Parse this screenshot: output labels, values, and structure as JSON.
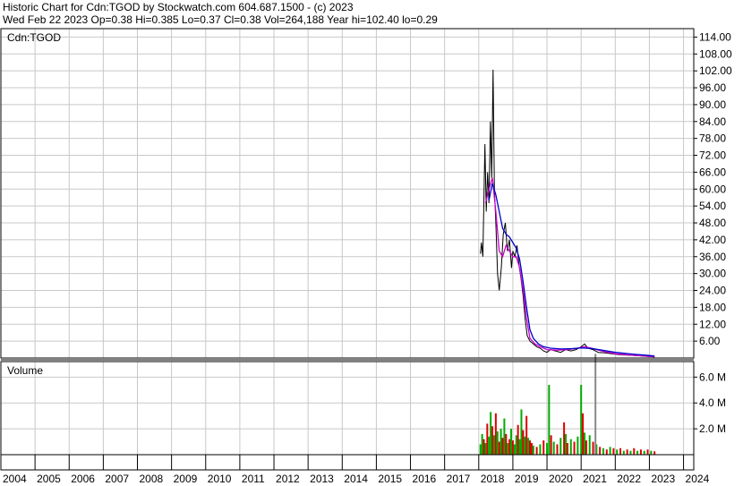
{
  "header": {
    "line1": "Historic Chart for Cdn:TGOD by Stockwatch.com 604.687.1500 - (c) 2023",
    "line2": "Wed Feb 22 2023   Op=0.38   Hi=0.385   Lo=0.37   Cl=0.38   Vol=264,188   Year hi=102.40   lo=0.29"
  },
  "colors": {
    "grid": "#c8c8c8",
    "price_line": "#000000",
    "ma_short": "#cc00cc",
    "ma_long": "#0000cc",
    "vol_up": "#00aa00",
    "vol_down": "#dd0000",
    "vol_spike": "#888888"
  },
  "chart_data": [
    {
      "type": "line",
      "panel_label": "Cdn:TGOD",
      "x_ticks": [
        "2004",
        "2005",
        "2006",
        "2007",
        "2008",
        "2009",
        "2010",
        "2011",
        "2012",
        "2013",
        "2014",
        "2015",
        "2016",
        "2017",
        "2018",
        "2019",
        "2020",
        "2021",
        "2022",
        "2023",
        "2024"
      ],
      "y_ticks": [
        "114.00",
        "108.00",
        "102.00",
        "96.00",
        "90.00",
        "84.00",
        "78.00",
        "72.00",
        "66.00",
        "60.00",
        "54.00",
        "48.00",
        "42.00",
        "36.00",
        "30.00",
        "24.00",
        "18.00",
        "12.00",
        "6.00"
      ],
      "ylim": [
        0,
        117
      ],
      "xlim": [
        2004.0,
        2024.3
      ],
      "grid": true,
      "series": [
        {
          "role": "price",
          "points": [
            [
              2018.05,
              37
            ],
            [
              2018.08,
              41
            ],
            [
              2018.12,
              36
            ],
            [
              2018.18,
              76
            ],
            [
              2018.22,
              52
            ],
            [
              2018.26,
              66
            ],
            [
              2018.3,
              55
            ],
            [
              2018.34,
              84
            ],
            [
              2018.38,
              64
            ],
            [
              2018.42,
              102.4
            ],
            [
              2018.46,
              60
            ],
            [
              2018.5,
              48
            ],
            [
              2018.55,
              30
            ],
            [
              2018.6,
              24
            ],
            [
              2018.66,
              32
            ],
            [
              2018.72,
              44
            ],
            [
              2018.78,
              48
            ],
            [
              2018.84,
              38
            ],
            [
              2018.9,
              42
            ],
            [
              2018.96,
              32
            ],
            [
              2019.0,
              38
            ],
            [
              2019.06,
              36
            ],
            [
              2019.12,
              40
            ],
            [
              2019.18,
              33
            ],
            [
              2019.24,
              28
            ],
            [
              2019.3,
              22
            ],
            [
              2019.36,
              14
            ],
            [
              2019.42,
              8
            ],
            [
              2019.5,
              6
            ],
            [
              2019.6,
              5
            ],
            [
              2019.7,
              4
            ],
            [
              2019.8,
              3.5
            ],
            [
              2019.9,
              2.5
            ],
            [
              2020.0,
              2
            ],
            [
              2020.1,
              3
            ],
            [
              2020.25,
              2.5
            ],
            [
              2020.4,
              2
            ],
            [
              2020.55,
              3
            ],
            [
              2020.7,
              2.5
            ],
            [
              2020.85,
              3
            ],
            [
              2021.0,
              4
            ],
            [
              2021.1,
              5
            ],
            [
              2021.2,
              3.5
            ],
            [
              2021.35,
              3
            ],
            [
              2021.5,
              2
            ],
            [
              2021.7,
              1.8
            ],
            [
              2021.9,
              1.5
            ],
            [
              2022.1,
              1.2
            ],
            [
              2022.4,
              1.0
            ],
            [
              2022.7,
              0.8
            ],
            [
              2023.0,
              0.5
            ],
            [
              2023.15,
              0.38
            ]
          ]
        },
        {
          "role": "moving-average-short",
          "points": [
            [
              2018.2,
              55
            ],
            [
              2018.3,
              60
            ],
            [
              2018.4,
              64
            ],
            [
              2018.5,
              52
            ],
            [
              2018.6,
              38
            ],
            [
              2018.7,
              36
            ],
            [
              2018.8,
              40
            ],
            [
              2018.9,
              38
            ],
            [
              2019.0,
              36
            ],
            [
              2019.1,
              36
            ],
            [
              2019.2,
              32
            ],
            [
              2019.3,
              24
            ],
            [
              2019.4,
              14
            ],
            [
              2019.5,
              7
            ],
            [
              2019.65,
              5
            ],
            [
              2019.8,
              4
            ],
            [
              2020.0,
              3
            ],
            [
              2020.3,
              2.8
            ],
            [
              2020.6,
              3
            ],
            [
              2020.9,
              3.5
            ],
            [
              2021.1,
              4
            ],
            [
              2021.3,
              3.5
            ],
            [
              2021.6,
              2.5
            ],
            [
              2022.0,
              1.5
            ],
            [
              2022.5,
              1.0
            ],
            [
              2023.0,
              0.6
            ],
            [
              2023.15,
              0.45
            ]
          ]
        },
        {
          "role": "moving-average-long",
          "points": [
            [
              2018.3,
              56
            ],
            [
              2018.4,
              62
            ],
            [
              2018.5,
              58
            ],
            [
              2018.6,
              52
            ],
            [
              2018.7,
              46
            ],
            [
              2018.8,
              44
            ],
            [
              2018.9,
              43
            ],
            [
              2019.0,
              41
            ],
            [
              2019.1,
              39
            ],
            [
              2019.2,
              35
            ],
            [
              2019.3,
              27
            ],
            [
              2019.4,
              18
            ],
            [
              2019.5,
              10
            ],
            [
              2019.6,
              7
            ],
            [
              2019.75,
              5
            ],
            [
              2019.9,
              4
            ],
            [
              2020.1,
              3.5
            ],
            [
              2020.4,
              3.2
            ],
            [
              2020.7,
              3.3
            ],
            [
              2021.0,
              3.6
            ],
            [
              2021.3,
              3.4
            ],
            [
              2021.6,
              2.8
            ],
            [
              2022.0,
              2.0
            ],
            [
              2022.5,
              1.4
            ],
            [
              2023.0,
              0.9
            ],
            [
              2023.15,
              0.7
            ]
          ]
        }
      ]
    },
    {
      "type": "bar",
      "panel_label": "Volume",
      "y_ticks": [
        "6.0 M",
        "4.0 M",
        "2.0 M"
      ],
      "ylim": [
        0,
        7.2
      ],
      "xlim": [
        2004.0,
        2024.3
      ],
      "grid": true,
      "bars": [
        [
          2018.05,
          0.8,
          "up"
        ],
        [
          2018.1,
          1.6,
          "up"
        ],
        [
          2018.15,
          1.2,
          "down"
        ],
        [
          2018.2,
          0.9,
          "up"
        ],
        [
          2018.25,
          2.4,
          "down"
        ],
        [
          2018.3,
          1.4,
          "up"
        ],
        [
          2018.35,
          3.3,
          "up"
        ],
        [
          2018.4,
          2.2,
          "down"
        ],
        [
          2018.45,
          1.5,
          "up"
        ],
        [
          2018.5,
          3.2,
          "down"
        ],
        [
          2018.55,
          1.8,
          "up"
        ],
        [
          2018.6,
          1.0,
          "down"
        ],
        [
          2018.65,
          2.0,
          "up"
        ],
        [
          2018.7,
          1.3,
          "down"
        ],
        [
          2018.75,
          2.8,
          "up"
        ],
        [
          2018.8,
          1.6,
          "down"
        ],
        [
          2018.85,
          0.9,
          "up"
        ],
        [
          2018.9,
          1.2,
          "down"
        ],
        [
          2018.95,
          2.0,
          "up"
        ],
        [
          2019.0,
          1.1,
          "down"
        ],
        [
          2019.05,
          0.8,
          "up"
        ],
        [
          2019.1,
          1.5,
          "up"
        ],
        [
          2019.15,
          2.3,
          "down"
        ],
        [
          2019.2,
          1.2,
          "up"
        ],
        [
          2019.25,
          3.5,
          "up"
        ],
        [
          2019.3,
          1.9,
          "down"
        ],
        [
          2019.35,
          1.4,
          "up"
        ],
        [
          2019.4,
          3.0,
          "down"
        ],
        [
          2019.45,
          1.3,
          "up"
        ],
        [
          2019.5,
          1.1,
          "down"
        ],
        [
          2019.55,
          0.9,
          "down"
        ],
        [
          2019.6,
          0.7,
          "up"
        ],
        [
          2019.7,
          0.6,
          "down"
        ],
        [
          2019.8,
          0.8,
          "up"
        ],
        [
          2019.9,
          1.1,
          "down"
        ],
        [
          2020.0,
          0.9,
          "up"
        ],
        [
          2020.06,
          5.4,
          "up"
        ],
        [
          2020.12,
          1.5,
          "down"
        ],
        [
          2020.2,
          1.0,
          "up"
        ],
        [
          2020.3,
          0.8,
          "down"
        ],
        [
          2020.4,
          1.3,
          "up"
        ],
        [
          2020.5,
          2.5,
          "down"
        ],
        [
          2020.55,
          1.6,
          "up"
        ],
        [
          2020.6,
          0.9,
          "down"
        ],
        [
          2020.7,
          1.2,
          "up"
        ],
        [
          2020.8,
          1.0,
          "down"
        ],
        [
          2020.9,
          1.4,
          "up"
        ],
        [
          2021.0,
          5.4,
          "up"
        ],
        [
          2021.05,
          3.2,
          "down"
        ],
        [
          2021.1,
          1.7,
          "up"
        ],
        [
          2021.15,
          1.1,
          "down"
        ],
        [
          2021.25,
          1.5,
          "up"
        ],
        [
          2021.35,
          1.0,
          "down"
        ],
        [
          2021.45,
          0.8,
          "up"
        ],
        [
          2021.55,
          0.6,
          "down"
        ],
        [
          2021.65,
          0.5,
          "up"
        ],
        [
          2021.75,
          0.4,
          "down"
        ],
        [
          2021.85,
          0.6,
          "up"
        ],
        [
          2021.95,
          0.5,
          "down"
        ],
        [
          2022.05,
          0.4,
          "up"
        ],
        [
          2022.15,
          0.5,
          "down"
        ],
        [
          2022.25,
          0.3,
          "up"
        ],
        [
          2022.35,
          0.4,
          "down"
        ],
        [
          2022.45,
          0.3,
          "up"
        ],
        [
          2022.55,
          0.5,
          "down"
        ],
        [
          2022.65,
          0.3,
          "up"
        ],
        [
          2022.75,
          0.4,
          "down"
        ],
        [
          2022.85,
          0.3,
          "up"
        ],
        [
          2022.95,
          0.4,
          "down"
        ],
        [
          2023.05,
          0.3,
          "up"
        ],
        [
          2023.15,
          0.26,
          "down"
        ],
        [
          2021.42,
          8.0,
          "spike"
        ]
      ]
    }
  ]
}
